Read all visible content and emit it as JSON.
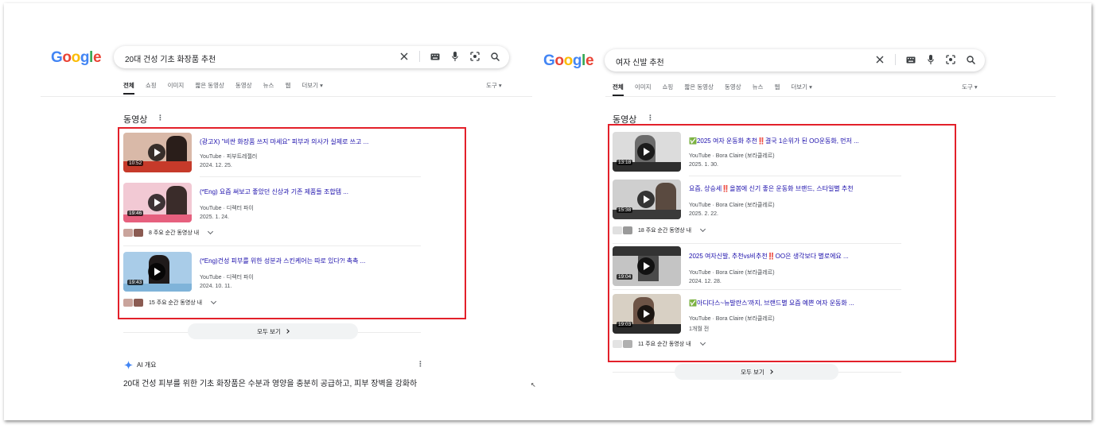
{
  "colors": {
    "accent_red": "#e3202a",
    "link_blue": "#1a0dab",
    "google_blue": "#4285f4",
    "google_red": "#ea4335",
    "google_yellow": "#fbbc05",
    "google_green": "#34a853"
  },
  "left": {
    "logo": "Google",
    "query": "20대 건성 기초 화장품 추천",
    "tabs": [
      "전체",
      "쇼핑",
      "이미지",
      "짧은 동영상",
      "동영상",
      "뉴스",
      "웹",
      "더보기"
    ],
    "tools": "도구",
    "section_title": "동영상",
    "videos": [
      {
        "title": "(광고X) \"비싼 화장품 쓰지 마세요\" 피부과 의사가 실제로 쓰고 ...",
        "source": "YouTube · 피부트레젤러",
        "date": "2024. 12. 25.",
        "duration": "10:52"
      },
      {
        "title": "(*Eng) 요즘 써보고 좋았던 신상과 기존 제품들 조합템 ...",
        "source": "YouTube · 디렉터 파이",
        "date": "2025. 1. 24.",
        "duration": "19:46",
        "moments": "8 주요 순간 동영상 내"
      },
      {
        "title": "(*Eng)건성 피부를 위한 성분과 스킨케어는 따로 있다?! 촉촉 ...",
        "source": "YouTube · 디렉터 파이",
        "date": "2024. 10. 11.",
        "duration": "19:43",
        "moments": "15 주요 순간 동영상 내"
      }
    ],
    "view_all": "모두 보기",
    "ai_overview": "AI 개요",
    "ai_text": "20대 건성 피부를 위한 기초 화장품은 수분과 영양을 충분히 공급하고, 피부 장벽을 강화하"
  },
  "right": {
    "logo": "Google",
    "query": "여자 신발 추천",
    "tabs": [
      "전체",
      "이미지",
      "쇼핑",
      "짧은 동영상",
      "동영상",
      "뉴스",
      "웹",
      "더보기"
    ],
    "tools": "도구",
    "section_title": "동영상",
    "videos": [
      {
        "title": "✅2025 여자 운동화 추천‼️결국 1순위가 된 OO운동화, 먼저 ...",
        "source": "YouTube · Bora Claire (보라클레르)",
        "date": "2025. 1. 30.",
        "duration": "13:18"
      },
      {
        "title": "요즘, 상승세‼️올봄에 신기 좋은 운동화 브랜드, 스타일별 추천",
        "source": "YouTube · Bora Claire (보라클레르)",
        "date": "2025. 2. 22.",
        "duration": "15:38",
        "moments": "18 주요 순간 동영상 내"
      },
      {
        "title": "2025 여자신발, 추천vs비추천‼️OO은 생각보다 별로에요 ...",
        "source": "YouTube · Bora Claire (보라클레르)",
        "date": "2024. 12. 28.",
        "duration": "19:04"
      },
      {
        "title": "✅아디다스~뉴발란스'까지, 브랜드별 요즘 예쁜 여자 운동화 ...",
        "source": "YouTube · Bora Claire (보라클레르)",
        "date": "1개월 전",
        "duration": "19:03",
        "moments": "11 주요 순간 동영상 내"
      }
    ],
    "view_all": "모두 보기"
  }
}
